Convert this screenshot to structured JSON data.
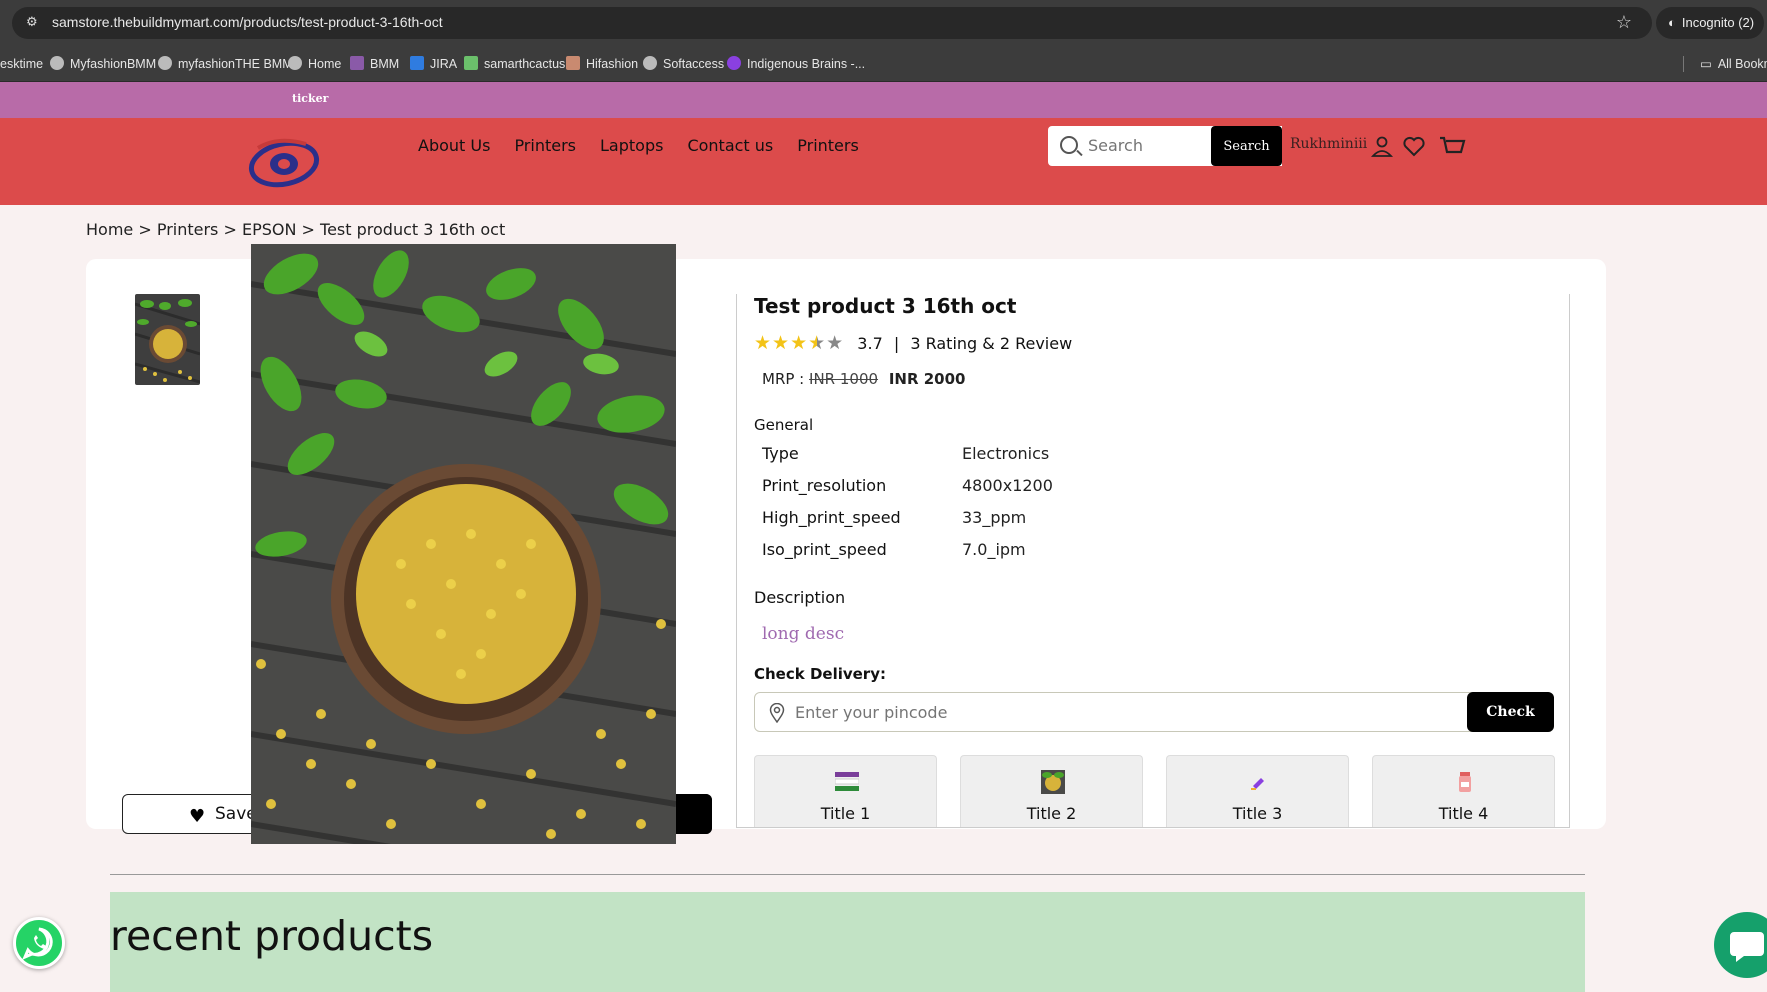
{
  "browser": {
    "url": "samstore.thebuildmymart.com/products/test-product-3-16th-oct",
    "incognito_label": "Incognito (2)",
    "bookmarks": [
      "esktime",
      "MyfashionBMM",
      "myfashionTHE BMM",
      "Home",
      "BMM",
      "JIRA",
      "samarthcactus",
      "Hifashion",
      "Softaccess",
      "Indigenous Brains -...",
      "All Bookmarks"
    ]
  },
  "ticker": {
    "text": "ticker"
  },
  "header": {
    "nav": [
      "About Us",
      "Printers",
      "Laptops",
      "Contact us",
      "Printers"
    ],
    "search_placeholder": "Search",
    "search_button": "Search",
    "user_name": "Rukhminiii"
  },
  "breadcrumb": "Home > Printers > EPSON > Test product 3 16th oct",
  "product": {
    "title": "Test product 3 16th oct",
    "rating_value": "3.7",
    "rating_text": "3 Rating & 2 Review",
    "mrp_label": "MRP :",
    "mrp_old": "INR 1000",
    "mrp_new": "INR 2000",
    "general_label": "General",
    "specs": [
      {
        "key": "Type",
        "value": "Electronics"
      },
      {
        "key": "Print_resolution",
        "value": "4800x1200"
      },
      {
        "key": "High_print_speed",
        "value": "33_ppm"
      },
      {
        "key": "Iso_print_speed",
        "value": "7.0_ipm"
      }
    ],
    "description_label": "Description",
    "description_value": "long desc",
    "check_delivery_label": "Check Delivery:",
    "pincode_placeholder": "Enter your pincode",
    "check_button": "Check",
    "save_label": "Save",
    "tiles": [
      "Title 1",
      "Title 2",
      "Title 3",
      "Title 4"
    ]
  },
  "recent": {
    "heading": "recent products"
  },
  "colors": {
    "header": "#dc4b4b",
    "ticker": "#b86ba8",
    "recent_bg": "#c2e3c5",
    "star": "#f3c317"
  }
}
